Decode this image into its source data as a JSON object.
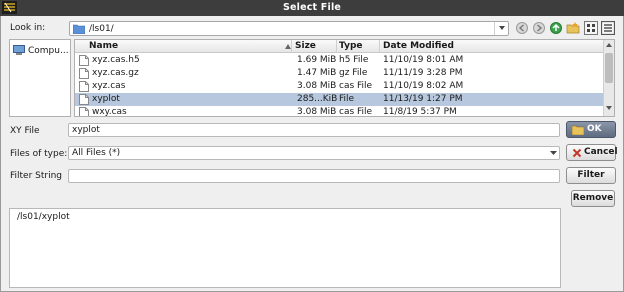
{
  "window": {
    "title": "Select File"
  },
  "look_in": {
    "label": "Look in:",
    "path": "/ls01/"
  },
  "places": [
    {
      "label": "Compu..."
    }
  ],
  "file_list": {
    "columns": [
      "Name",
      "Size",
      "Type",
      "Date Modified"
    ],
    "sort_column": "Name",
    "rows": [
      {
        "name": "xyz.cas.h5",
        "size": "1.69 MiB",
        "type": "h5 File",
        "modified": "11/10/19 8:01 AM",
        "selected": false
      },
      {
        "name": "xyz.cas.gz",
        "size": "1.47 MiB",
        "type": "gz File",
        "modified": "11/11/19 3:28 PM",
        "selected": false
      },
      {
        "name": "xyz.cas",
        "size": "3.08 MiB",
        "type": "cas File",
        "modified": "11/10/19 8:02 AM",
        "selected": false
      },
      {
        "name": "xyplot",
        "size": "285...KiB",
        "type": "File",
        "modified": "11/13/19 1:27 PM",
        "selected": true
      },
      {
        "name": "wxy.cas",
        "size": "3.08 MiB",
        "type": "cas File",
        "modified": "11/8/19 5:37 PM",
        "selected": false
      }
    ]
  },
  "xy_file": {
    "label": "XY File",
    "value": "xyplot"
  },
  "files_of_type": {
    "label": "Files of type:",
    "value": "All Files (*)"
  },
  "filter_string": {
    "label": "Filter String",
    "value": ""
  },
  "buttons": {
    "ok": "OK",
    "cancel": "Cancel",
    "filter": "Filter",
    "remove": "Remove"
  },
  "preview": {
    "text": "/ls01/xyplot"
  },
  "colors": {
    "title_bar": "#3d3d3d",
    "selection": "#b7c7dd",
    "ok_button": "#5e6b80",
    "cancel_x": "#c0392b"
  },
  "icons": [
    "app-logo-icon",
    "folder-icon",
    "chevron-down-icon",
    "back-icon",
    "forward-icon",
    "up-folder-icon",
    "new-folder-icon",
    "list-view-icon",
    "detail-view-icon",
    "computer-icon",
    "file-icon",
    "sort-arrow-icon",
    "ok-folder-icon",
    "cancel-x-icon"
  ]
}
